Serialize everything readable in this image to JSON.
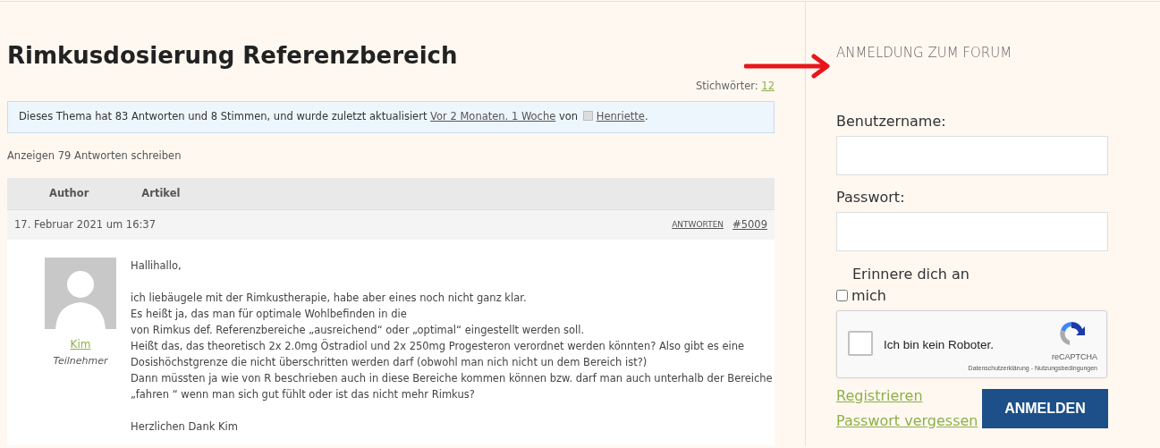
{
  "topic": {
    "title": "Rimkusdosierung Referenzbereich",
    "tags_label": "Stichwörter:",
    "tags_count": "12",
    "info": {
      "text": "Dieses Thema hat 83 Antworten und 8 Stimmen, und wurde zuletzt aktualisiert",
      "time_link": "Vor 2 Monaten. 1 Woche",
      "by": "von",
      "user_link": "Henriette",
      "end": "."
    },
    "reply_count": "Anzeigen 79 Antworten schreiben"
  },
  "table": {
    "columns": [
      "Author",
      "Artikel"
    ]
  },
  "post": {
    "date": "17. Februar 2021 um 16:37",
    "reply_link": "ANTWORTEN",
    "number": "#5009",
    "author": "Kim",
    "role": "Teilnehmer",
    "paragraphs": [
      [
        "Hallihallo,"
      ],
      [
        "ich liebäugele mit der Rimkustherapie, habe aber eines noch nicht ganz klar.",
        "Es heißt ja, das man für optimale Wohlbefinden in die",
        "von Rimkus def. Referenzbereiche „ausreichend“ oder „optimal“ eingestellt werden soll.",
        "Heißt das, das theoretisch 2x 2.0mg Östradiol und 2x 250mg Progesteron verordnet werden könnten? Also gibt es eine",
        "Dosishöchstgrenze die nicht überschritten werden darf (obwohl man nich nicht un dem Bereich ist?)",
        "Dann müssten ja wie von R beschrieben auch in diese Bereiche kommen können bzw. darf man auch unterhalb der Bereiche",
        "„fahren “ wenn man sich gut fühlt oder ist das nicht mehr Rimkus?"
      ],
      [
        "Herzlichen Dank Kim"
      ]
    ]
  },
  "sidebar": {
    "heading": "ANMELDUNG ZUM FORUM",
    "username_label": "Benutzername:",
    "password_label": "Passwort:",
    "remember": {
      "label_line1": "Erinnere dich an",
      "label_line2": "mich",
      "checked": false
    },
    "captcha": {
      "label": "Ich bin kein Roboter.",
      "checked": false,
      "brand": "reCAPTCHA",
      "privacy": "Datenschutzerklärung",
      "separator": "-",
      "terms": "Nutzungsbedingungen"
    },
    "links": [
      "Registrieren",
      "Passwort vergessen"
    ],
    "submit": "ANMELDEN"
  }
}
